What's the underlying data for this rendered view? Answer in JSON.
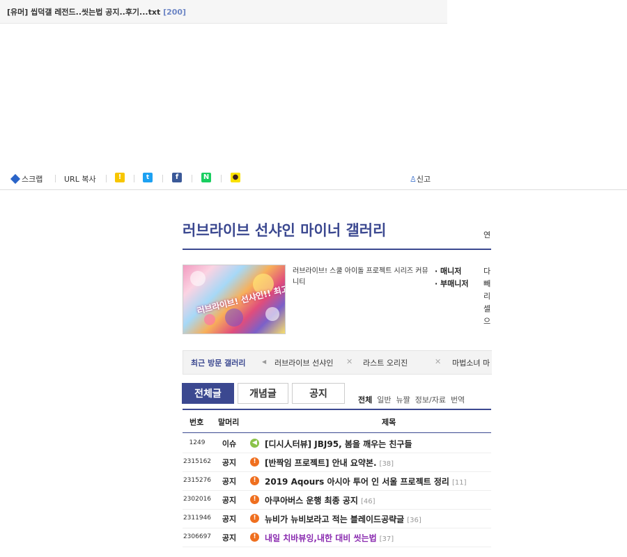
{
  "top_post": {
    "title": "[유머] 씹덕갤 레전드..씻는법 공지..후기...txt",
    "comments": "[200]"
  },
  "share_bar": {
    "scrap_label": "스크랩",
    "url_copy_label": "URL 복사",
    "kakaostory_icon": "kakaostory-icon",
    "twitter_icon": "twitter-icon",
    "facebook_icon": "facebook-icon",
    "naver_icon": "naver-icon",
    "kakaotalk_icon": "kakaotalk-icon",
    "report_label": "신고",
    "colors": {
      "kakaostory": "#f7c600",
      "twitter": "#1da1f2",
      "facebook": "#3b5998",
      "naver": "#19ce60",
      "kakaotalk": "#fae100"
    }
  },
  "gallery": {
    "title": "러브라이브 선샤인 마이너 갤러리",
    "side_char": "연",
    "description": "러브라이브! 스쿨 아이돌 프로젝트 시리즈 커뮤니티",
    "manager_label": "· 매니저",
    "submanager_label": "· 부매니저",
    "side_column": "다빼리셀으",
    "thumbnail_text": "러브라이브! 선샤인!! 최고!"
  },
  "recent_visit": {
    "label": "최근 방문 갤러리",
    "items": [
      "러브라이브 선샤인",
      "라스트 오리진",
      "마법소녀 마"
    ]
  },
  "tabs": [
    "전체글",
    "개념글",
    "공지"
  ],
  "filters": [
    "전체",
    "일반",
    "뉴짤",
    "정보/자료",
    "번역"
  ],
  "table": {
    "headers": {
      "num": "번호",
      "head": "말머리",
      "subject": "제목"
    },
    "rows": [
      {
        "num": "1249",
        "head": "이슈",
        "icon": "issue",
        "subject": "[디시人터뷰] JBJ95, 봄을 깨우는 친구들",
        "comments": ""
      },
      {
        "num": "2315162",
        "head": "공지",
        "icon": "notice",
        "subject": "[반짝임 프로젝트] 안내 요약본.",
        "comments": "[38]"
      },
      {
        "num": "2315276",
        "head": "공지",
        "icon": "notice",
        "subject": "2019 Aqours 아시아 투어 인 서울 프로젝트 정리",
        "comments": "[11]"
      },
      {
        "num": "2302016",
        "head": "공지",
        "icon": "notice",
        "subject": "아쿠아버스 운행 최종 공지",
        "comments": "[46]"
      },
      {
        "num": "2311946",
        "head": "공지",
        "icon": "notice",
        "subject": "뉴비가 뉴비보라고 적는 블레이드공략글",
        "comments": "[36]"
      },
      {
        "num": "2306697",
        "head": "공지",
        "icon": "notice",
        "subject": "내일 치바뷰잉,내한 대비 씻는법",
        "comments": "[37]"
      }
    ]
  },
  "colors": {
    "accent": "#3b4890",
    "notice_icon": "#ef6f1f",
    "issue_icon": "#8bc34a",
    "visited_link": "#8a2bb0",
    "comment_count_top": "#6d86c5"
  }
}
